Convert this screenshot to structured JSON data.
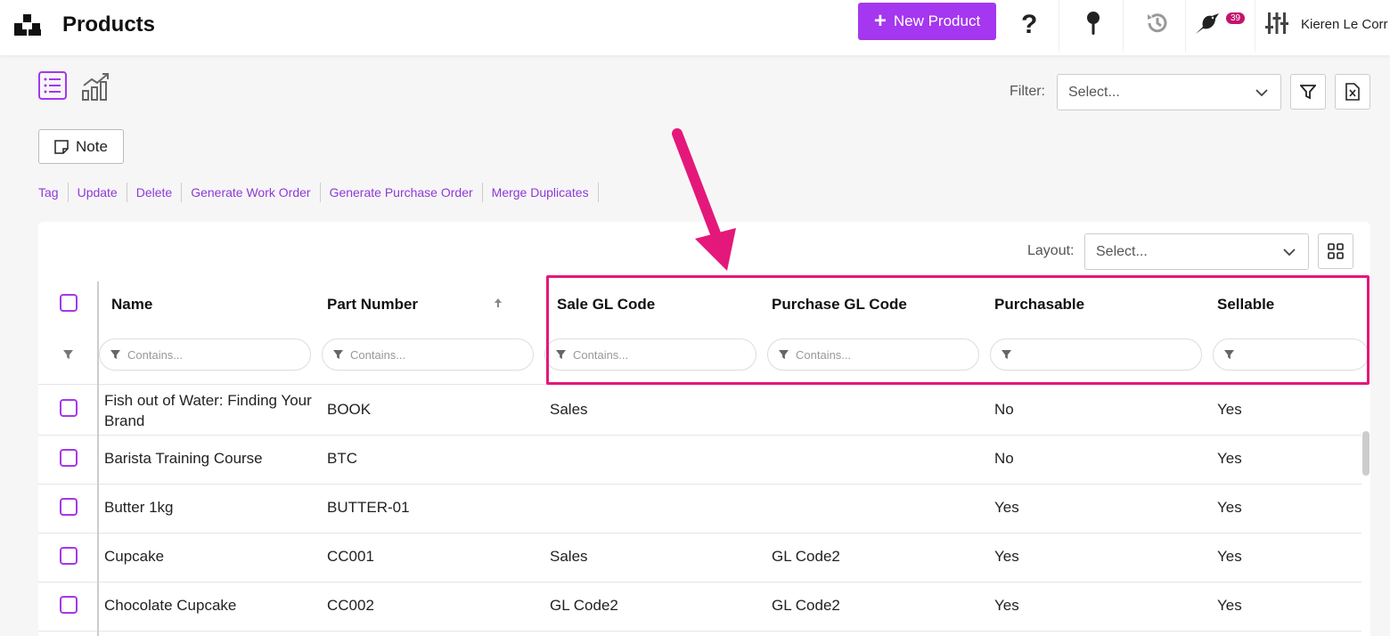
{
  "header": {
    "title": "Products",
    "new_product_label": "New Product",
    "notification_count": "39",
    "user_name": "Kieren Le Corr"
  },
  "toolbar": {
    "filter_label": "Filter:",
    "filter_placeholder": "Select...",
    "note_label": "Note",
    "layout_label": "Layout:",
    "layout_placeholder": "Select..."
  },
  "actions": [
    "Tag",
    "Update",
    "Delete",
    "Generate Work Order",
    "Generate Purchase Order",
    "Merge Duplicates"
  ],
  "table": {
    "columns": [
      "Name",
      "Part Number",
      "Sale GL Code",
      "Purchase GL Code",
      "Purchasable",
      "Sellable"
    ],
    "filter_placeholder": "Contains...",
    "rows": [
      [
        "Fish out of Water: Finding Your Brand",
        "BOOK",
        "Sales",
        "",
        "No",
        "Yes"
      ],
      [
        "Barista Training Course",
        "BTC",
        "",
        "",
        "No",
        "Yes"
      ],
      [
        "Butter 1kg",
        "BUTTER-01",
        "",
        "",
        "Yes",
        "Yes"
      ],
      [
        "Cupcake",
        "CC001",
        "Sales",
        "GL Code2",
        "Yes",
        "Yes"
      ],
      [
        "Chocolate Cupcake",
        "CC002",
        "GL Code2",
        "GL Code2",
        "Yes",
        "Yes"
      ]
    ]
  },
  "colors": {
    "accent": "#a437ef",
    "highlight": "#e4187a",
    "link": "#8e3ad8"
  }
}
